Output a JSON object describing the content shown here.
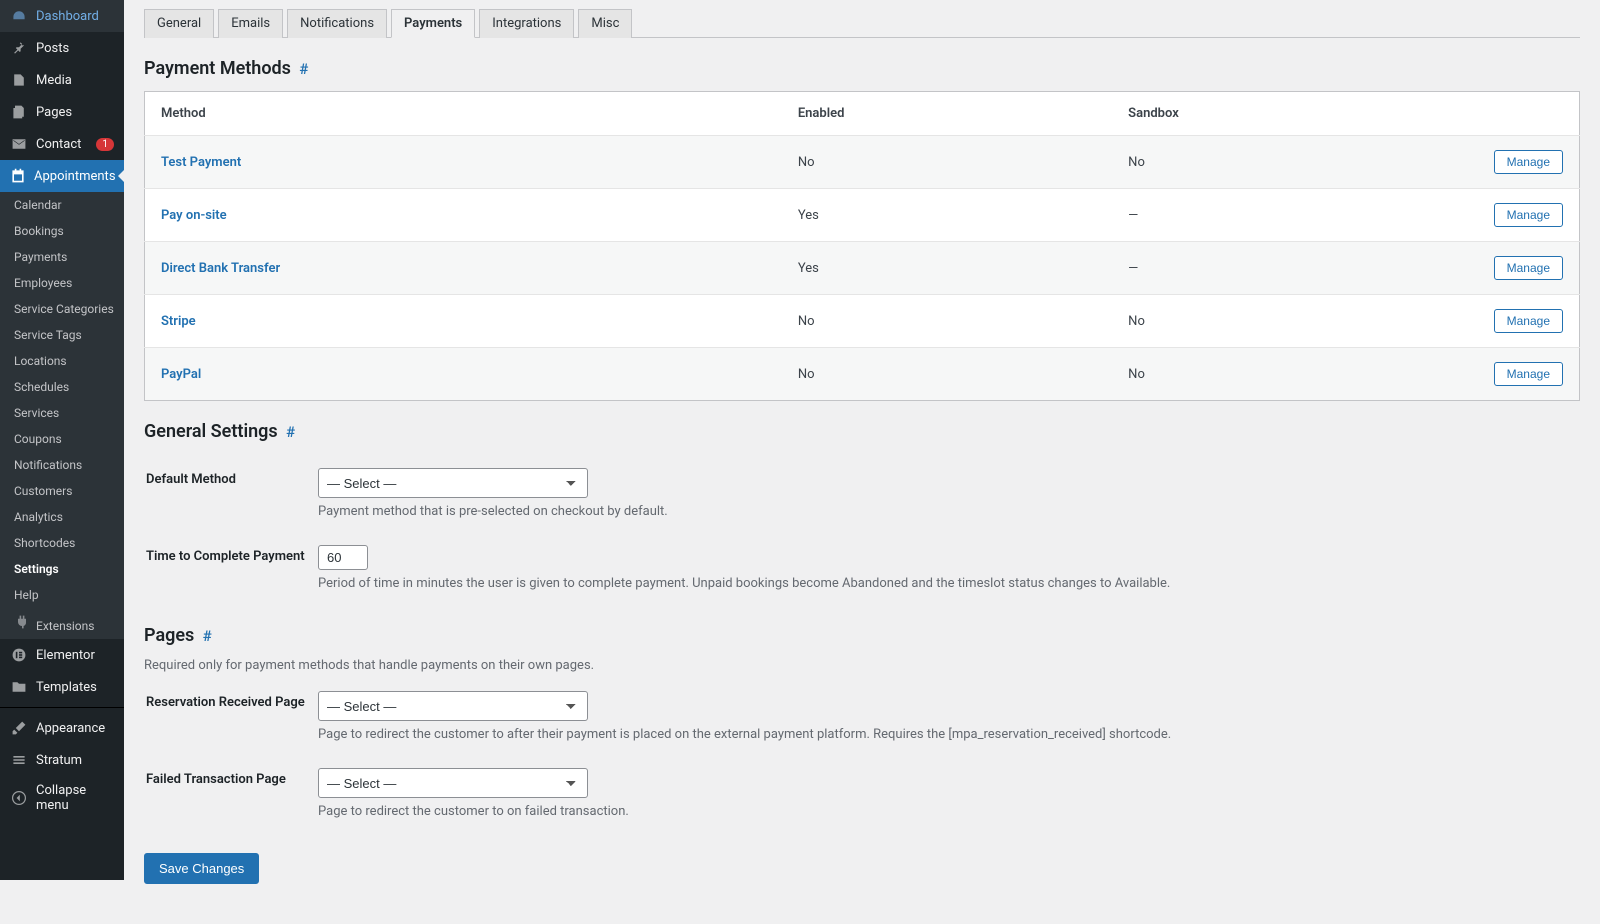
{
  "sidebar": {
    "items": [
      {
        "name": "dashboard",
        "label": "Dashboard",
        "icon": "gauge"
      },
      {
        "name": "posts",
        "label": "Posts",
        "icon": "pin"
      },
      {
        "name": "media",
        "label": "Media",
        "icon": "media"
      },
      {
        "name": "pages",
        "label": "Pages",
        "icon": "pages"
      },
      {
        "name": "contact",
        "label": "Contact",
        "icon": "mail",
        "badge": "1"
      },
      {
        "name": "appointments",
        "label": "Appointments",
        "icon": "calendar",
        "current": true
      }
    ],
    "submenu": [
      {
        "label": "Calendar"
      },
      {
        "label": "Bookings"
      },
      {
        "label": "Payments"
      },
      {
        "label": "Employees"
      },
      {
        "label": "Service Categories"
      },
      {
        "label": "Service Tags"
      },
      {
        "label": "Locations"
      },
      {
        "label": "Schedules"
      },
      {
        "label": "Services"
      },
      {
        "label": "Coupons"
      },
      {
        "label": "Notifications"
      },
      {
        "label": "Customers"
      },
      {
        "label": "Analytics"
      },
      {
        "label": "Shortcodes"
      },
      {
        "label": "Settings",
        "current": true
      },
      {
        "label": "Help"
      },
      {
        "label": "Extensions",
        "icon": "plug"
      }
    ],
    "items2": [
      {
        "name": "elementor",
        "label": "Elementor",
        "icon": "elementor"
      },
      {
        "name": "templates",
        "label": "Templates",
        "icon": "folder"
      }
    ],
    "items3": [
      {
        "name": "appearance",
        "label": "Appearance",
        "icon": "brush"
      },
      {
        "name": "stratum",
        "label": "Stratum",
        "icon": "stratum"
      },
      {
        "name": "collapse",
        "label": "Collapse menu",
        "icon": "collapse"
      }
    ]
  },
  "tabs": [
    {
      "label": "General"
    },
    {
      "label": "Emails"
    },
    {
      "label": "Notifications"
    },
    {
      "label": "Payments",
      "active": true
    },
    {
      "label": "Integrations"
    },
    {
      "label": "Misc"
    }
  ],
  "sections": {
    "methods_title": "Payment Methods",
    "settings_title": "General Settings",
    "pages_title": "Pages",
    "pages_desc": "Required only for payment methods that handle payments on their own pages."
  },
  "table": {
    "cols": {
      "method": "Method",
      "enabled": "Enabled",
      "sandbox": "Sandbox"
    },
    "manage_label": "Manage",
    "rows": [
      {
        "method": "Test Payment",
        "enabled": "No",
        "sandbox": "No"
      },
      {
        "method": "Pay on-site",
        "enabled": "Yes",
        "sandbox": "—"
      },
      {
        "method": "Direct Bank Transfer",
        "enabled": "Yes",
        "sandbox": "—"
      },
      {
        "method": "Stripe",
        "enabled": "No",
        "sandbox": "No"
      },
      {
        "method": "PayPal",
        "enabled": "No",
        "sandbox": "No"
      }
    ]
  },
  "form": {
    "default_method": {
      "label": "Default Method",
      "value": "— Select —",
      "desc": "Payment method that is pre-selected on checkout by default."
    },
    "time_complete": {
      "label": "Time to Complete Payment",
      "value": "60",
      "desc": "Period of time in minutes the user is given to complete payment. Unpaid bookings become Abandoned and the timeslot status changes to Available."
    },
    "reservation_page": {
      "label": "Reservation Received Page",
      "value": "— Select —",
      "desc": "Page to redirect the customer to after their payment is placed on the external payment platform. Requires the [mpa_reservation_received] shortcode."
    },
    "failed_page": {
      "label": "Failed Transaction Page",
      "value": "— Select —",
      "desc": "Page to redirect the customer to on failed transaction."
    }
  },
  "save_label": "Save Changes"
}
